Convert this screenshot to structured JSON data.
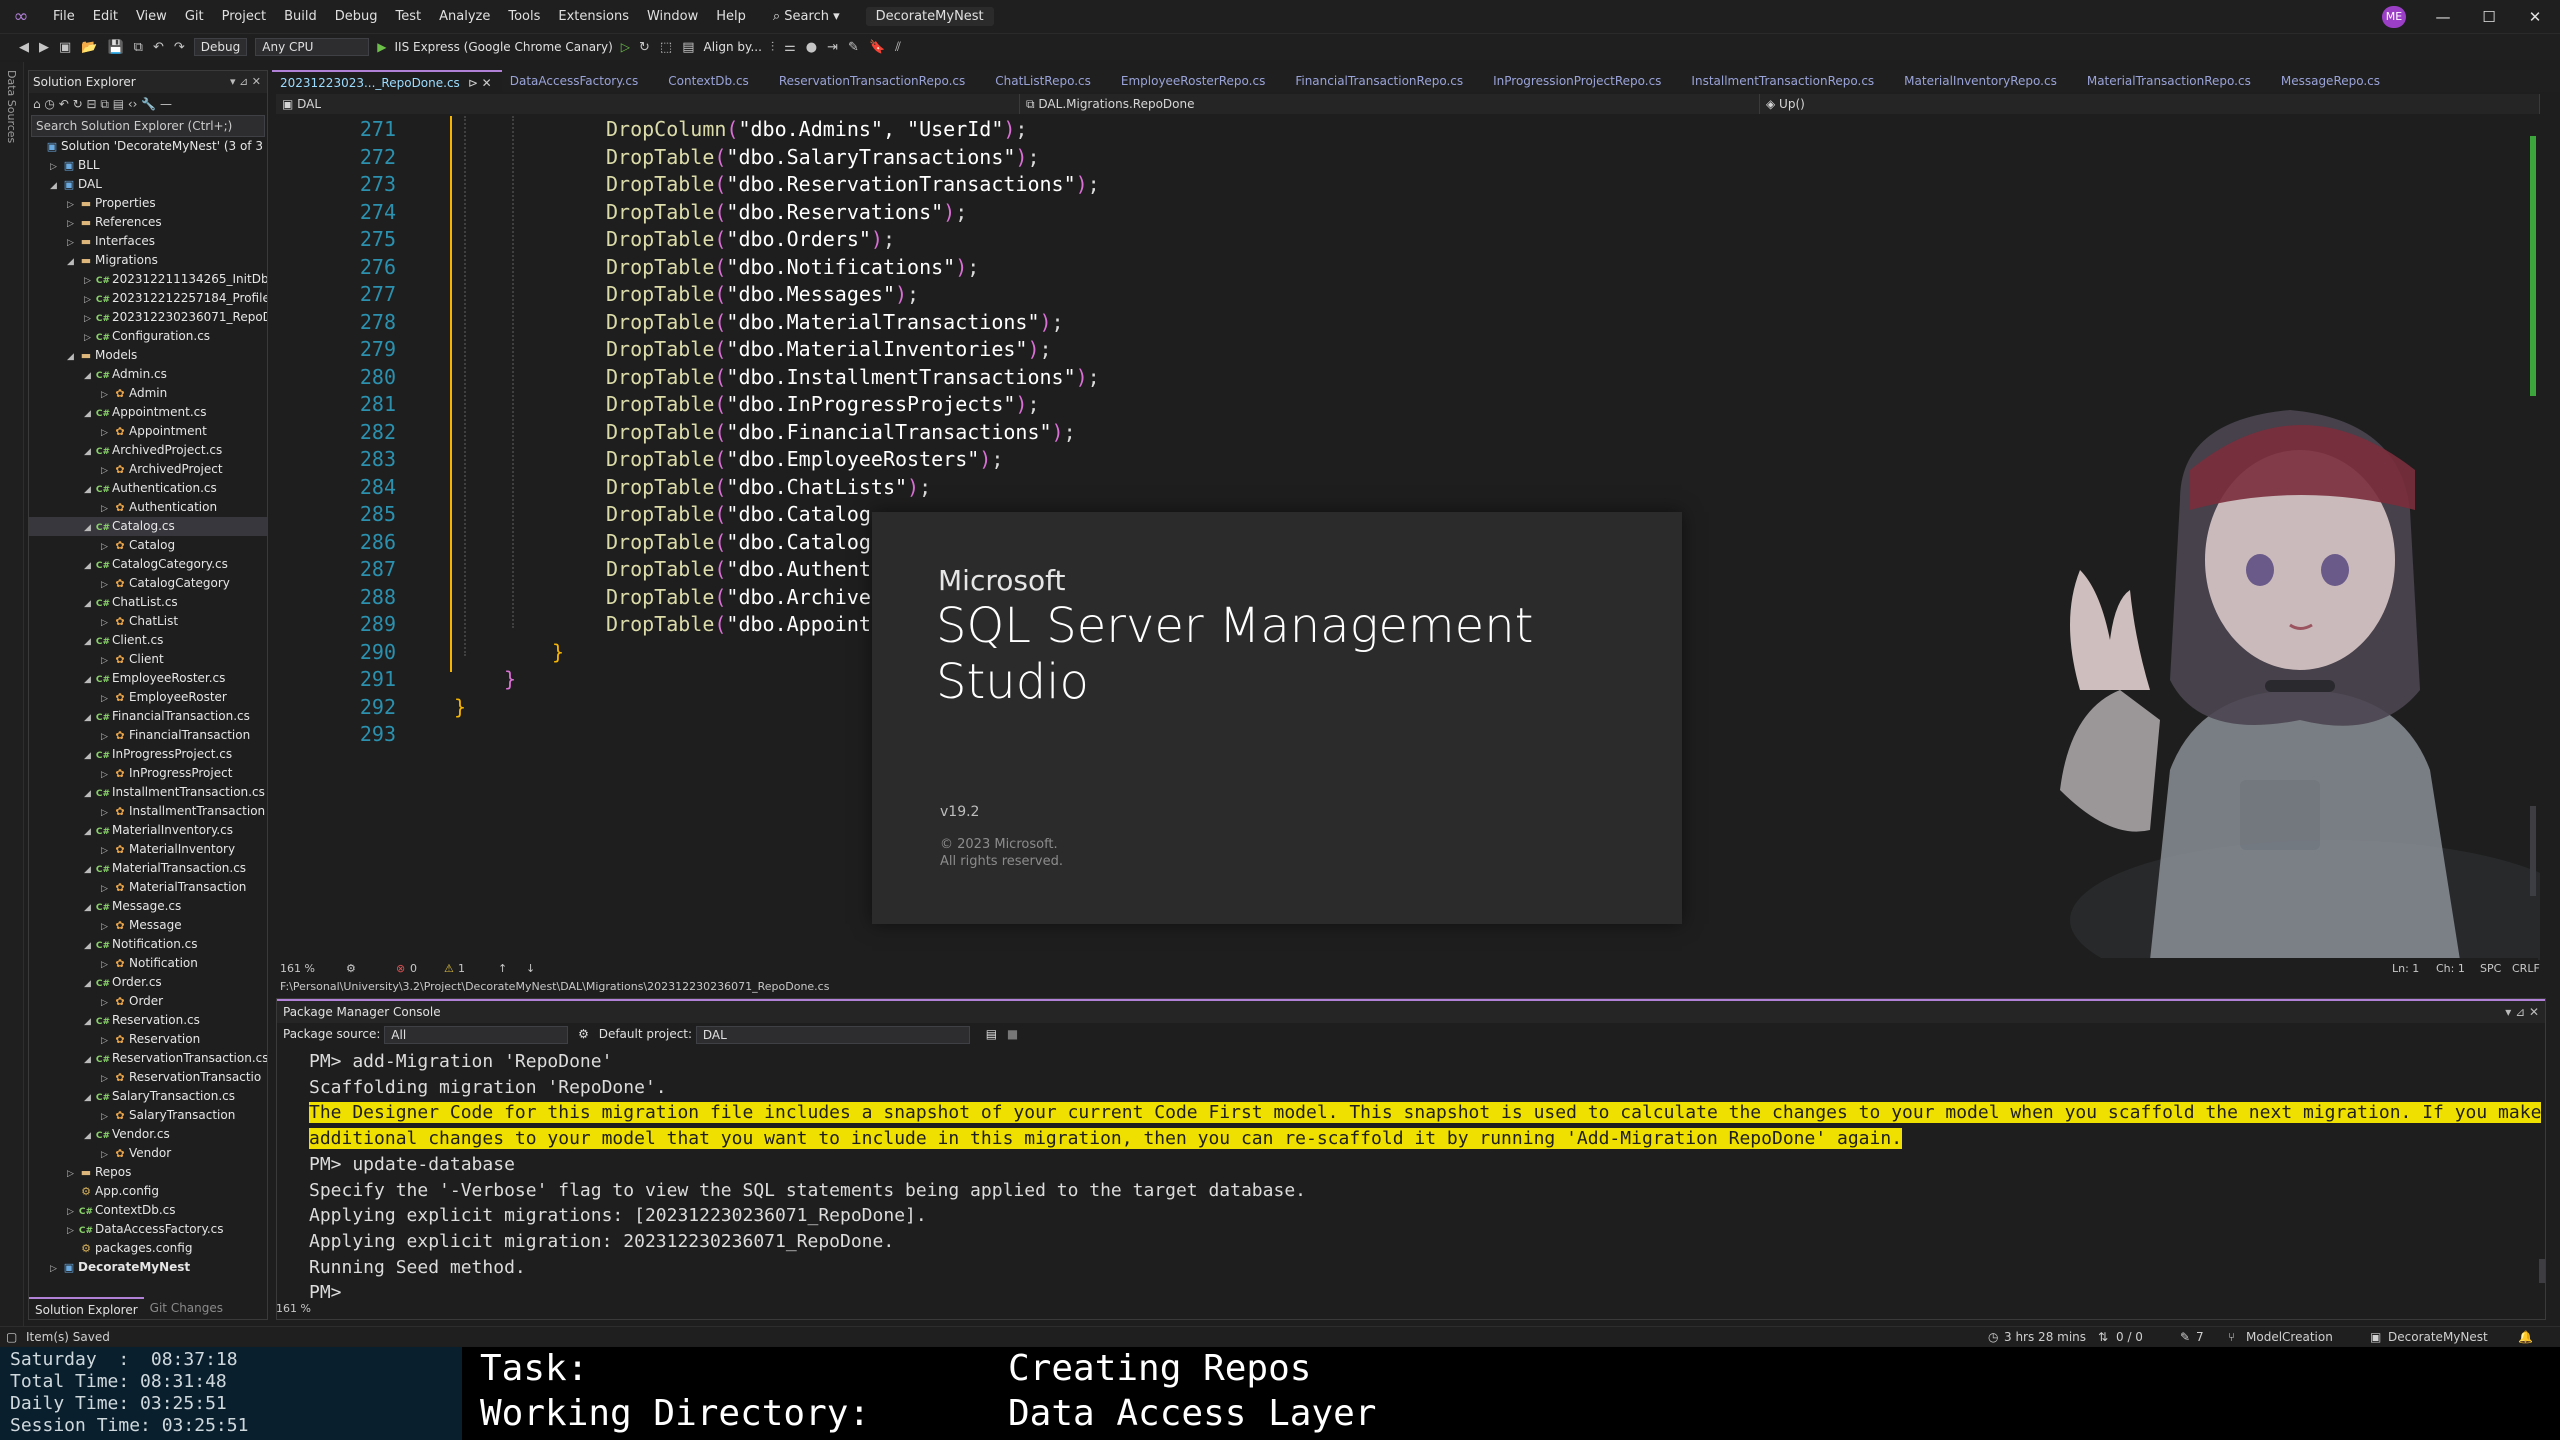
{
  "menu": [
    "File",
    "Edit",
    "View",
    "Git",
    "Project",
    "Build",
    "Debug",
    "Test",
    "Analyze",
    "Tools",
    "Extensions",
    "Window",
    "Help"
  ],
  "search_label": "Search",
  "solution_title": "DecorateMyNest",
  "avatar_initials": "ME",
  "toolbar": {
    "config": "Debug",
    "platform": "Any CPU",
    "run_target": "IIS Express (Google Chrome Canary)",
    "align": "Align by..."
  },
  "left_strip_label": "Data Sources",
  "solution_explorer": {
    "title": "Solution Explorer",
    "search_placeholder": "Search Solution Explorer (Ctrl+;)",
    "tree": [
      {
        "label": "Solution 'DecorateMyNest' (3 of 3 p",
        "depth": 0,
        "arrow": "",
        "icon": "proj"
      },
      {
        "label": "BLL",
        "depth": 1,
        "arrow": "▷",
        "icon": "proj"
      },
      {
        "label": "DAL",
        "depth": 1,
        "arrow": "◢",
        "icon": "proj"
      },
      {
        "label": "Properties",
        "depth": 2,
        "arrow": "▷",
        "icon": "folder"
      },
      {
        "label": "References",
        "depth": 2,
        "arrow": "▷",
        "icon": "folder"
      },
      {
        "label": "Interfaces",
        "depth": 2,
        "arrow": "▷",
        "icon": "folder"
      },
      {
        "label": "Migrations",
        "depth": 2,
        "arrow": "◢",
        "icon": "folder"
      },
      {
        "label": "202312211134265_InitDb.c",
        "depth": 3,
        "arrow": "▷",
        "icon": "cs"
      },
      {
        "label": "202312212257184_ProfileF",
        "depth": 3,
        "arrow": "▷",
        "icon": "cs"
      },
      {
        "label": "202312230236071_RepoDo",
        "depth": 3,
        "arrow": "▷",
        "icon": "cs"
      },
      {
        "label": "Configuration.cs",
        "depth": 3,
        "arrow": "▷",
        "icon": "cs"
      },
      {
        "label": "Models",
        "depth": 2,
        "arrow": "◢",
        "icon": "folder"
      },
      {
        "label": "Admin.cs",
        "depth": 3,
        "arrow": "◢",
        "icon": "cs"
      },
      {
        "label": "Admin",
        "depth": 4,
        "arrow": "▷",
        "icon": "cls"
      },
      {
        "label": "Appointment.cs",
        "depth": 3,
        "arrow": "◢",
        "icon": "cs"
      },
      {
        "label": "Appointment",
        "depth": 4,
        "arrow": "▷",
        "icon": "cls"
      },
      {
        "label": "ArchivedProject.cs",
        "depth": 3,
        "arrow": "◢",
        "icon": "cs"
      },
      {
        "label": "ArchivedProject",
        "depth": 4,
        "arrow": "▷",
        "icon": "cls"
      },
      {
        "label": "Authentication.cs",
        "depth": 3,
        "arrow": "◢",
        "icon": "cs"
      },
      {
        "label": "Authentication",
        "depth": 4,
        "arrow": "▷",
        "icon": "cls"
      },
      {
        "label": "Catalog.cs",
        "depth": 3,
        "arrow": "◢",
        "icon": "cs",
        "selected": true
      },
      {
        "label": "Catalog",
        "depth": 4,
        "arrow": "▷",
        "icon": "cls"
      },
      {
        "label": "CatalogCategory.cs",
        "depth": 3,
        "arrow": "◢",
        "icon": "cs"
      },
      {
        "label": "CatalogCategory",
        "depth": 4,
        "arrow": "▷",
        "icon": "cls"
      },
      {
        "label": "ChatList.cs",
        "depth": 3,
        "arrow": "◢",
        "icon": "cs"
      },
      {
        "label": "ChatList",
        "depth": 4,
        "arrow": "▷",
        "icon": "cls"
      },
      {
        "label": "Client.cs",
        "depth": 3,
        "arrow": "◢",
        "icon": "cs"
      },
      {
        "label": "Client",
        "depth": 4,
        "arrow": "▷",
        "icon": "cls"
      },
      {
        "label": "EmployeeRoster.cs",
        "depth": 3,
        "arrow": "◢",
        "icon": "cs"
      },
      {
        "label": "EmployeeRoster",
        "depth": 4,
        "arrow": "▷",
        "icon": "cls"
      },
      {
        "label": "FinancialTransaction.cs",
        "depth": 3,
        "arrow": "◢",
        "icon": "cs"
      },
      {
        "label": "FinancialTransaction",
        "depth": 4,
        "arrow": "▷",
        "icon": "cls"
      },
      {
        "label": "InProgressProject.cs",
        "depth": 3,
        "arrow": "◢",
        "icon": "cs"
      },
      {
        "label": "InProgressProject",
        "depth": 4,
        "arrow": "▷",
        "icon": "cls"
      },
      {
        "label": "InstallmentTransaction.cs",
        "depth": 3,
        "arrow": "◢",
        "icon": "cs"
      },
      {
        "label": "InstallmentTransaction",
        "depth": 4,
        "arrow": "▷",
        "icon": "cls"
      },
      {
        "label": "MaterialInventory.cs",
        "depth": 3,
        "arrow": "◢",
        "icon": "cs"
      },
      {
        "label": "MaterialInventory",
        "depth": 4,
        "arrow": "▷",
        "icon": "cls"
      },
      {
        "label": "MaterialTransaction.cs",
        "depth": 3,
        "arrow": "◢",
        "icon": "cs"
      },
      {
        "label": "MaterialTransaction",
        "depth": 4,
        "arrow": "▷",
        "icon": "cls"
      },
      {
        "label": "Message.cs",
        "depth": 3,
        "arrow": "◢",
        "icon": "cs"
      },
      {
        "label": "Message",
        "depth": 4,
        "arrow": "▷",
        "icon": "cls"
      },
      {
        "label": "Notification.cs",
        "depth": 3,
        "arrow": "◢",
        "icon": "cs"
      },
      {
        "label": "Notification",
        "depth": 4,
        "arrow": "▷",
        "icon": "cls"
      },
      {
        "label": "Order.cs",
        "depth": 3,
        "arrow": "◢",
        "icon": "cs"
      },
      {
        "label": "Order",
        "depth": 4,
        "arrow": "▷",
        "icon": "cls"
      },
      {
        "label": "Reservation.cs",
        "depth": 3,
        "arrow": "◢",
        "icon": "cs"
      },
      {
        "label": "Reservation",
        "depth": 4,
        "arrow": "▷",
        "icon": "cls"
      },
      {
        "label": "ReservationTransaction.cs",
        "depth": 3,
        "arrow": "◢",
        "icon": "cs"
      },
      {
        "label": "ReservationTransactio",
        "depth": 4,
        "arrow": "▷",
        "icon": "cls"
      },
      {
        "label": "SalaryTransaction.cs",
        "depth": 3,
        "arrow": "◢",
        "icon": "cs"
      },
      {
        "label": "SalaryTransaction",
        "depth": 4,
        "arrow": "▷",
        "icon": "cls"
      },
      {
        "label": "Vendor.cs",
        "depth": 3,
        "arrow": "◢",
        "icon": "cs"
      },
      {
        "label": "Vendor",
        "depth": 4,
        "arrow": "▷",
        "icon": "cls"
      },
      {
        "label": "Repos",
        "depth": 2,
        "arrow": "▷",
        "icon": "folder"
      },
      {
        "label": "App.config",
        "depth": 2,
        "arrow": "",
        "icon": "cfg"
      },
      {
        "label": "ContextDb.cs",
        "depth": 2,
        "arrow": "▷",
        "icon": "cs"
      },
      {
        "label": "DataAccessFactory.cs",
        "depth": 2,
        "arrow": "▷",
        "icon": "cs"
      },
      {
        "label": "packages.config",
        "depth": 2,
        "arrow": "",
        "icon": "cfg"
      },
      {
        "label": "DecorateMyNest",
        "depth": 1,
        "arrow": "▷",
        "icon": "proj",
        "bold": true
      }
    ],
    "bottom_tabs": [
      "Solution Explorer",
      "Git Changes"
    ]
  },
  "doc_tabs": [
    "20231223023..._RepoDone.cs",
    "DataAccessFactory.cs",
    "ContextDb.cs",
    "ReservationTransactionRepo.cs",
    "ChatListRepo.cs",
    "EmployeeRosterRepo.cs",
    "FinancialTransactionRepo.cs",
    "InProgressionProjectRepo.cs",
    "InstallmentTransactionRepo.cs",
    "MaterialInventoryRepo.cs",
    "MaterialTransactionRepo.cs",
    "MessageRepo.cs"
  ],
  "navbar": {
    "project": "DAL",
    "class": "DAL.Migrations.RepoDone",
    "member": "Up()"
  },
  "code_lines": [
    {
      "n": "271",
      "fn": "DropColumn",
      "args": "\"dbo.Admins\", \"UserId\""
    },
    {
      "n": "272",
      "fn": "DropTable",
      "args": "\"dbo.SalaryTransactions\""
    },
    {
      "n": "273",
      "fn": "DropTable",
      "args": "\"dbo.ReservationTransactions\""
    },
    {
      "n": "274",
      "fn": "DropTable",
      "args": "\"dbo.Reservations\""
    },
    {
      "n": "275",
      "fn": "DropTable",
      "args": "\"dbo.Orders\""
    },
    {
      "n": "276",
      "fn": "DropTable",
      "args": "\"dbo.Notifications\""
    },
    {
      "n": "277",
      "fn": "DropTable",
      "args": "\"dbo.Messages\""
    },
    {
      "n": "278",
      "fn": "DropTable",
      "args": "\"dbo.MaterialTransactions\""
    },
    {
      "n": "279",
      "fn": "DropTable",
      "args": "\"dbo.MaterialInventories\""
    },
    {
      "n": "280",
      "fn": "DropTable",
      "args": "\"dbo.InstallmentTransactions\""
    },
    {
      "n": "281",
      "fn": "DropTable",
      "args": "\"dbo.InProgressProjects\""
    },
    {
      "n": "282",
      "fn": "DropTable",
      "args": "\"dbo.FinancialTransactions\""
    },
    {
      "n": "283",
      "fn": "DropTable",
      "args": "\"dbo.EmployeeRosters\""
    },
    {
      "n": "284",
      "fn": "DropTable",
      "args": "\"dbo.ChatLists\""
    },
    {
      "n": "285",
      "fn": "DropTable",
      "args": "\"dbo.Catalog"
    },
    {
      "n": "286",
      "fn": "DropTable",
      "args": "\"dbo.Catalog"
    },
    {
      "n": "287",
      "fn": "DropTable",
      "args": "\"dbo.Authent"
    },
    {
      "n": "288",
      "fn": "DropTable",
      "args": "\"dbo.Archive"
    },
    {
      "n": "289",
      "fn": "DropTable",
      "args": "\"dbo.Appoint"
    }
  ],
  "closing_lines": [
    {
      "n": "290",
      "text": "}"
    },
    {
      "n": "291",
      "text": "}"
    },
    {
      "n": "292",
      "text": "}"
    },
    {
      "n": "293",
      "text": ""
    }
  ],
  "splash": {
    "brand": "Microsoft",
    "product": "SQL Server Management Studio",
    "version": "v19.2",
    "copyright": "© 2023 Microsoft.",
    "rights": "All rights reserved."
  },
  "editor_status": {
    "zoom": "161 %",
    "errors": "0",
    "warnings": "1",
    "line": "Ln: 1",
    "col": "Ch: 1",
    "spc": "SPC",
    "eol": "CRLF",
    "path": "F:\\Personal\\University\\3.2\\Project\\DecorateMyNest\\DAL\\Migrations\\202312230236071_RepoDone.cs"
  },
  "pmc": {
    "title": "Package Manager Console",
    "source_label": "Package source:",
    "source_value": "All",
    "default_project_label": "Default project:",
    "default_project_value": "DAL",
    "zoom": "161 %",
    "lines": [
      {
        "text": "PM> add-Migration 'RepoDone'",
        "hl": false
      },
      {
        "text": "Scaffolding migration 'RepoDone'.",
        "hl": false
      },
      {
        "text": "The Designer Code for this migration file includes a snapshot of your current Code First model. This snapshot is used to calculate the changes to your model when you scaffold the next migration. If you make",
        "hl": true
      },
      {
        "text": "additional changes to your model that you want to include in this migration, then you can re-scaffold it by running 'Add-Migration RepoDone' again.",
        "hl": true
      },
      {
        "text": "PM> update-database",
        "hl": false
      },
      {
        "text": "Specify the '-Verbose' flag to view the SQL statements being applied to the target database.",
        "hl": false
      },
      {
        "text": "Applying explicit migrations: [202312230236071_RepoDone].",
        "hl": false
      },
      {
        "text": "Applying explicit migration: 202312230236071_RepoDone.",
        "hl": false
      },
      {
        "text": "Running Seed method.",
        "hl": false
      },
      {
        "text": "PM>",
        "hl": false
      }
    ]
  },
  "status_bar": {
    "saved": "Item(s) Saved",
    "time": "3 hrs 28 mins",
    "git_sync": "0 / 0",
    "pending": "7",
    "branch": "ModelCreation",
    "repo": "DecorateMyNest"
  },
  "overlay": {
    "day_label": "Saturday  :  08:37:18",
    "total": "Total Time: 08:31:48",
    "daily": "Daily Time: 03:25:51",
    "session": "Session Time: 03:25:51",
    "task_label": "Task:",
    "task_value": "Creating Repos",
    "wd_label": "Working Directory:",
    "wd_value": "Data Access Layer"
  }
}
